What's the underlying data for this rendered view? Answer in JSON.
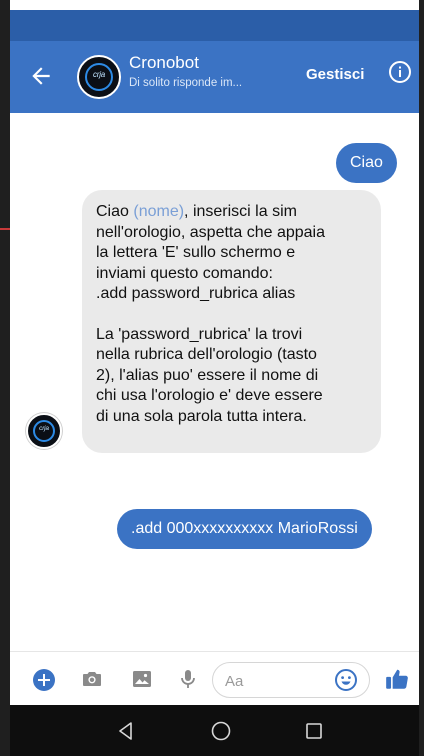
{
  "header": {
    "title": "Cronobot",
    "subtitle": "Di solito risponde im...",
    "manage_label": "Gestisci",
    "avatar_label": "crja"
  },
  "messages": [
    {
      "direction": "outgoing",
      "text": "Ciao"
    },
    {
      "direction": "incoming",
      "lines": {
        "l1_before": "Ciao ",
        "l1_name": "(nome)",
        "l1_after": ", inserisci la sim",
        "l2": "nell'orologio, aspetta che appaia",
        "l3": "la lettera 'E' sullo schermo e",
        "l4": "inviami questo comando:",
        "l5": ".add password_rubrica alias",
        "l6": "La 'password_rubrica' la trovi",
        "l7": "nella rubrica dell'orologio (tasto",
        "l8": "2), l'alias puo' essere il nome di",
        "l9": "chi usa l'orologio e' deve essere",
        "l10": "di una sola parola tutta intera."
      }
    },
    {
      "direction": "outgoing",
      "text": ".add 000xxxxxxxxxx MarioRossi"
    }
  ],
  "composer": {
    "placeholder": "Aa"
  },
  "colors": {
    "accent": "#3b73c4",
    "status_bar": "#2b5ea8",
    "incoming_bubble": "#eaeaea",
    "nav_bar": "#0e0e0e"
  },
  "icons": {
    "back": "back-arrow-icon",
    "info": "info-icon",
    "plus": "plus-icon",
    "camera": "camera-icon",
    "image": "image-icon",
    "mic": "microphone-icon",
    "emoji": "emoji-icon",
    "like": "thumbs-up-icon",
    "nav_back": "nav-back-icon",
    "nav_home": "nav-home-icon",
    "nav_recent": "nav-recent-icon"
  }
}
